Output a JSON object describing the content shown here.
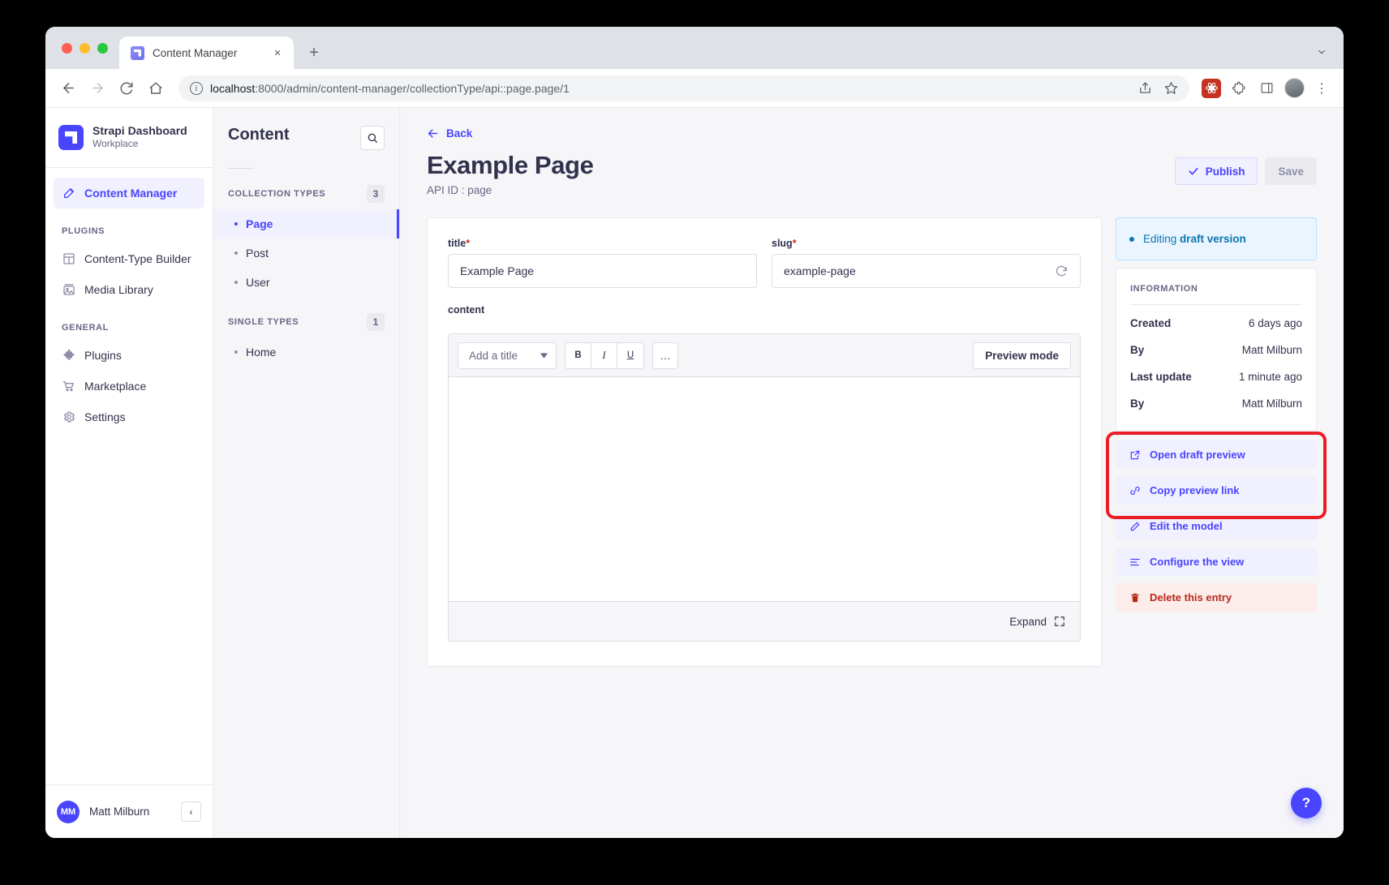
{
  "browser": {
    "tab": {
      "title": "Content Manager",
      "favicon": "strapi-logo-icon",
      "close": "×"
    },
    "new_tab": "+",
    "tabstrip_menu": "⌄",
    "url": "localhost:8000/admin/content-manager/collectionType/api::page.page/1",
    "url_host": "localhost",
    "url_path": ":8000/admin/content-manager/collectionType/api::page.page/1",
    "nav": {
      "back": "←",
      "forward": "→",
      "reload": "⟳",
      "home": "⌂"
    },
    "actions": {
      "share": "share-icon",
      "bookmark": "star-icon",
      "extension": "extension-icon",
      "puzzle": "puzzle-icon",
      "sidepanel": "sidepanel-icon",
      "profile": "avatar-icon",
      "menu": "⋮"
    }
  },
  "sidebar": {
    "brand_name": "Strapi Dashboard",
    "brand_sub": "Workplace",
    "main_item": {
      "label": "Content Manager",
      "icon": "pencil-square-icon"
    },
    "sections": [
      {
        "label": "PLUGINS",
        "items": [
          {
            "label": "Content-Type Builder",
            "icon": "layout-icon"
          },
          {
            "label": "Media Library",
            "icon": "image-icon"
          }
        ]
      },
      {
        "label": "GENERAL",
        "items": [
          {
            "label": "Plugins",
            "icon": "puzzle-icon"
          },
          {
            "label": "Marketplace",
            "icon": "cart-icon"
          },
          {
            "label": "Settings",
            "icon": "gear-icon"
          }
        ]
      }
    ],
    "user": {
      "initials": "MM",
      "name": "Matt Milburn",
      "collapse": "‹"
    }
  },
  "subnav": {
    "title": "Content",
    "search_icon": "search-icon",
    "collection_types": {
      "label": "COLLECTION TYPES",
      "count": "3",
      "items": [
        {
          "label": "Page",
          "active": true
        },
        {
          "label": "Post",
          "active": false
        },
        {
          "label": "User",
          "active": false
        }
      ]
    },
    "single_types": {
      "label": "SINGLE TYPES",
      "count": "1",
      "items": [
        {
          "label": "Home",
          "active": false
        }
      ]
    }
  },
  "main": {
    "back_label": "Back",
    "back_icon": "arrow-left-icon",
    "title": "Example Page",
    "api_id": "API ID : page",
    "publish_label": "Publish",
    "publish_icon": "check-icon",
    "save_label": "Save",
    "fields": {
      "title": {
        "label": "title",
        "required": "*",
        "value": "Example Page"
      },
      "slug": {
        "label": "slug",
        "required": "*",
        "value": "example-page",
        "regenerate_icon": "refresh-icon"
      },
      "content": {
        "label": "content"
      }
    },
    "editor": {
      "title_select": "Add a title",
      "select_caret": "▾",
      "bold": "B",
      "italic": "I",
      "underline": "U",
      "more": "…",
      "preview_mode": "Preview mode",
      "expand": "Expand",
      "expand_icon": "expand-icon"
    }
  },
  "rail": {
    "status_prefix": "Editing ",
    "status_strong": "draft version",
    "information_label": "INFORMATION",
    "info_rows": [
      {
        "key": "Created",
        "value": "6 days ago"
      },
      {
        "key": "By",
        "value": "Matt Milburn"
      },
      {
        "key": "Last update",
        "value": "1 minute ago"
      },
      {
        "key": "By",
        "value": "Matt Milburn"
      }
    ],
    "actions": [
      {
        "label": "Open draft preview",
        "icon": "external-link-icon",
        "danger": false
      },
      {
        "label": "Copy preview link",
        "icon": "link-icon",
        "danger": false
      },
      {
        "label": "Edit the model",
        "icon": "pencil-icon",
        "danger": false
      },
      {
        "label": "Configure the view",
        "icon": "sliders-icon",
        "danger": false
      },
      {
        "label": "Delete this entry",
        "icon": "trash-icon",
        "danger": true
      }
    ],
    "annotation_color": "#ec1c24"
  },
  "help": {
    "label": "?"
  }
}
